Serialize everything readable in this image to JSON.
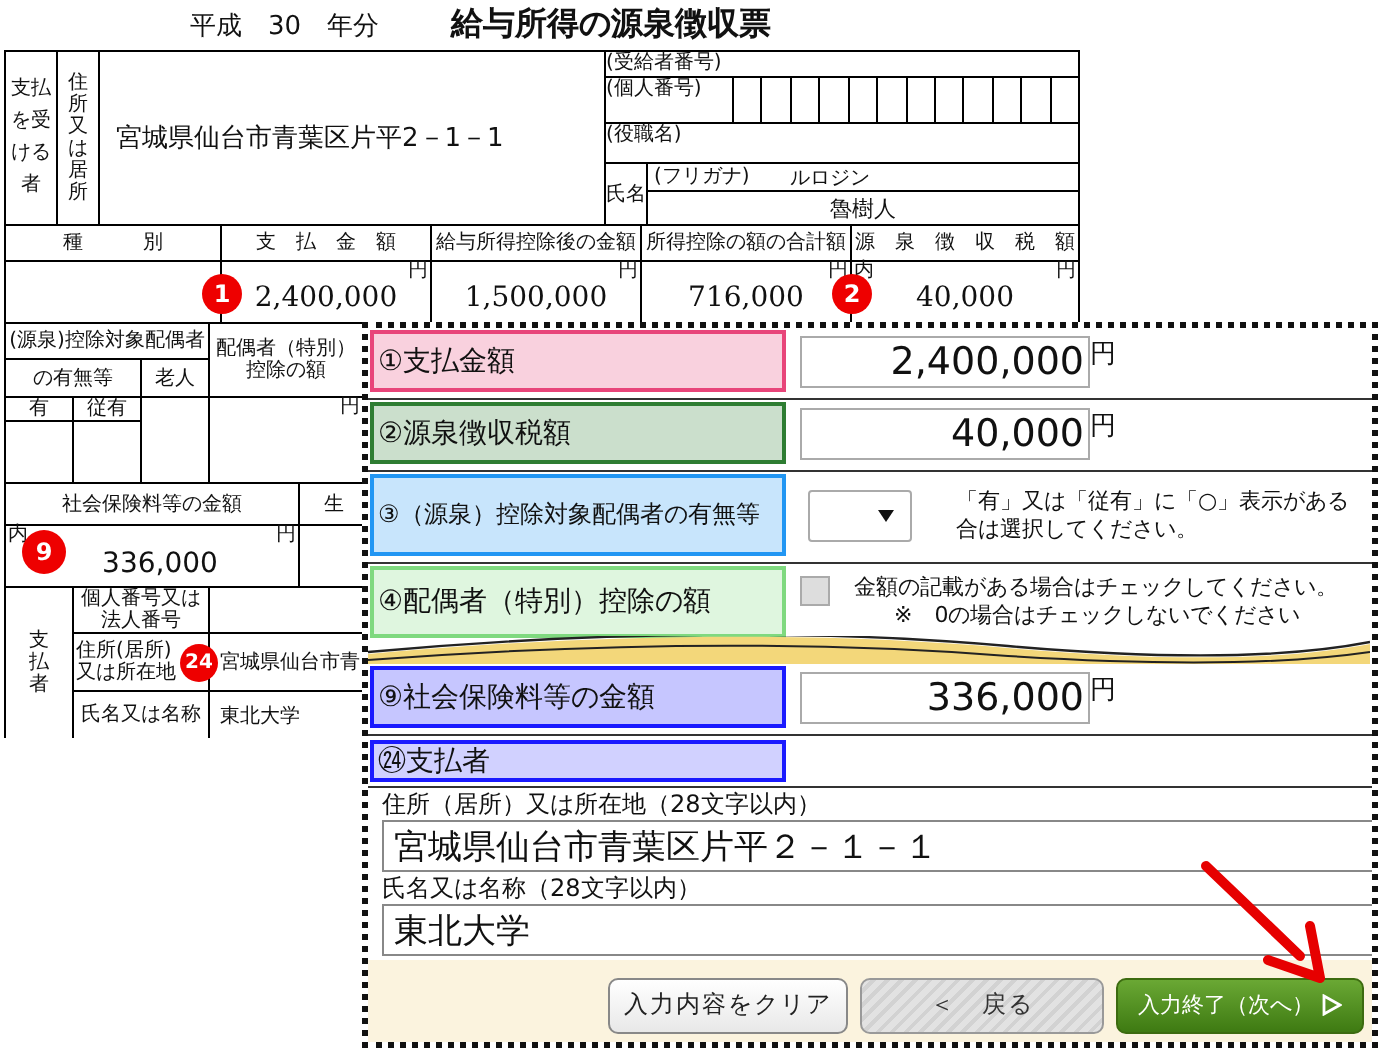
{
  "document": {
    "year": "平成　30　年分",
    "title": "給与所得の源泉徴収票",
    "recipient": {
      "label": "支払を受ける者",
      "address_label": "住所又は居所",
      "address": "宮城県仙台市青葉区片平2－1－1",
      "recipient_number_label": "(受給者番号)",
      "personal_number_label": "(個人番号)",
      "position_label": "(役職名)",
      "name_label": "氏名",
      "furigana_label": "(フリガナ)",
      "furigana": "ルロジン",
      "name": "魯樹人"
    },
    "amount_columns": [
      {
        "header": "種　　　別"
      },
      {
        "header": "支　払　金　額",
        "unit": "円",
        "value": "2,400,000",
        "badge": "1"
      },
      {
        "header": "給与所得控除後の金額",
        "unit": "円",
        "value": "1,500,000"
      },
      {
        "header": "所得控除の額の合計額",
        "unit": "円",
        "value": "716,000"
      },
      {
        "header": "源　泉　徴　収　税　額",
        "inner_mark": "内",
        "unit": "円",
        "value": "40,000",
        "badge": "2"
      }
    ],
    "spouse": {
      "header": "(源泉)控除対象配偶者",
      "sub_header": "の有無等",
      "elderly": "老人",
      "deduction_header": "配偶者（特別）控除の額",
      "has": "有",
      "dependent_has": "従有",
      "unit": "円"
    },
    "social_insurance": {
      "header": "社会保険料等の金額",
      "next_header": "生",
      "inner_mark": "内",
      "unit": "円",
      "value": "336,000",
      "badge": "9"
    },
    "payer": {
      "label": "支払者",
      "number_label": "個人番号又は法人番号",
      "address_label": "住所(居所)又は所在地",
      "address": "宮城県仙台市青",
      "name_label": "氏名又は名称",
      "name": "東北大学",
      "badge": "24"
    }
  },
  "form": {
    "rows": [
      {
        "kind": "amount",
        "label": "①支払金額",
        "color": "#e8457a",
        "value": "2,400,000",
        "unit": "円"
      },
      {
        "kind": "amount",
        "label": "②源泉徴収税額",
        "color": "#2e7d32",
        "value": "40,000",
        "unit": "円"
      },
      {
        "kind": "select",
        "label": "③（源泉）控除対象配偶者の有無等",
        "color": "#2196f3",
        "note_lines": [
          "「有」又は「従有」に「○」表示がある",
          "合は選択してください。"
        ]
      },
      {
        "kind": "checkbox",
        "label": "④配偶者（特別）控除の額",
        "color": "#7fd97f",
        "checked": false,
        "note_lines": [
          "金額の記載がある場合はチェックしてください。",
          "※　0の場合はチェックしないでください"
        ]
      },
      {
        "kind": "break"
      },
      {
        "kind": "amount",
        "label": "⑨社会保険料等の金額",
        "color": "#1a1aff",
        "value": "336,000",
        "unit": "円"
      }
    ],
    "payer": {
      "label": "㉔支払者",
      "color": "#1a1aff",
      "fields": [
        {
          "label": "住所（居所）又は所在地（28文字以内）",
          "value": "宮城県仙台市青葉区片平２－１－１"
        },
        {
          "label": "氏名又は名称（28文字以内）",
          "value": "東北大学"
        }
      ]
    },
    "buttons": [
      {
        "label": "入力内容をクリア",
        "kind": "plain"
      },
      {
        "label": "＜　戻る",
        "kind": "back"
      },
      {
        "label": "入力終了（次へ）",
        "kind": "primary"
      }
    ]
  }
}
